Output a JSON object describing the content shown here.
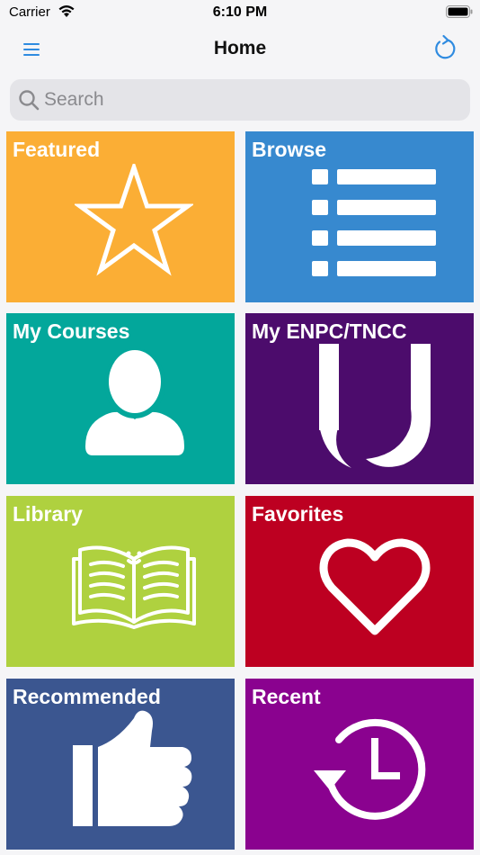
{
  "status_bar": {
    "carrier": "Carrier",
    "time": "6:10 PM"
  },
  "nav": {
    "title": "Home",
    "menu_icon": "hamburger-menu-icon",
    "refresh_icon": "refresh-icon",
    "accent_color": "#2f8be0"
  },
  "search": {
    "placeholder": "Search",
    "value": ""
  },
  "tiles": [
    {
      "label": "Featured",
      "icon": "star-icon",
      "color": "#fbae35"
    },
    {
      "label": "Browse",
      "icon": "list-icon",
      "color": "#3789cf"
    },
    {
      "label": "My Courses",
      "icon": "user-icon",
      "color": "#03a79b"
    },
    {
      "label": "My ENPC/TNCC",
      "icon": "enpc-logo-icon",
      "color": "#4c0c6c"
    },
    {
      "label": "Library",
      "icon": "book-icon",
      "color": "#afd13f"
    },
    {
      "label": "Favorites",
      "icon": "heart-icon",
      "color": "#bd0021"
    },
    {
      "label": "Recommended",
      "icon": "thumbs-up-icon",
      "color": "#3b5690"
    },
    {
      "label": "Recent",
      "icon": "history-clock-icon",
      "color": "#8a028f"
    }
  ]
}
